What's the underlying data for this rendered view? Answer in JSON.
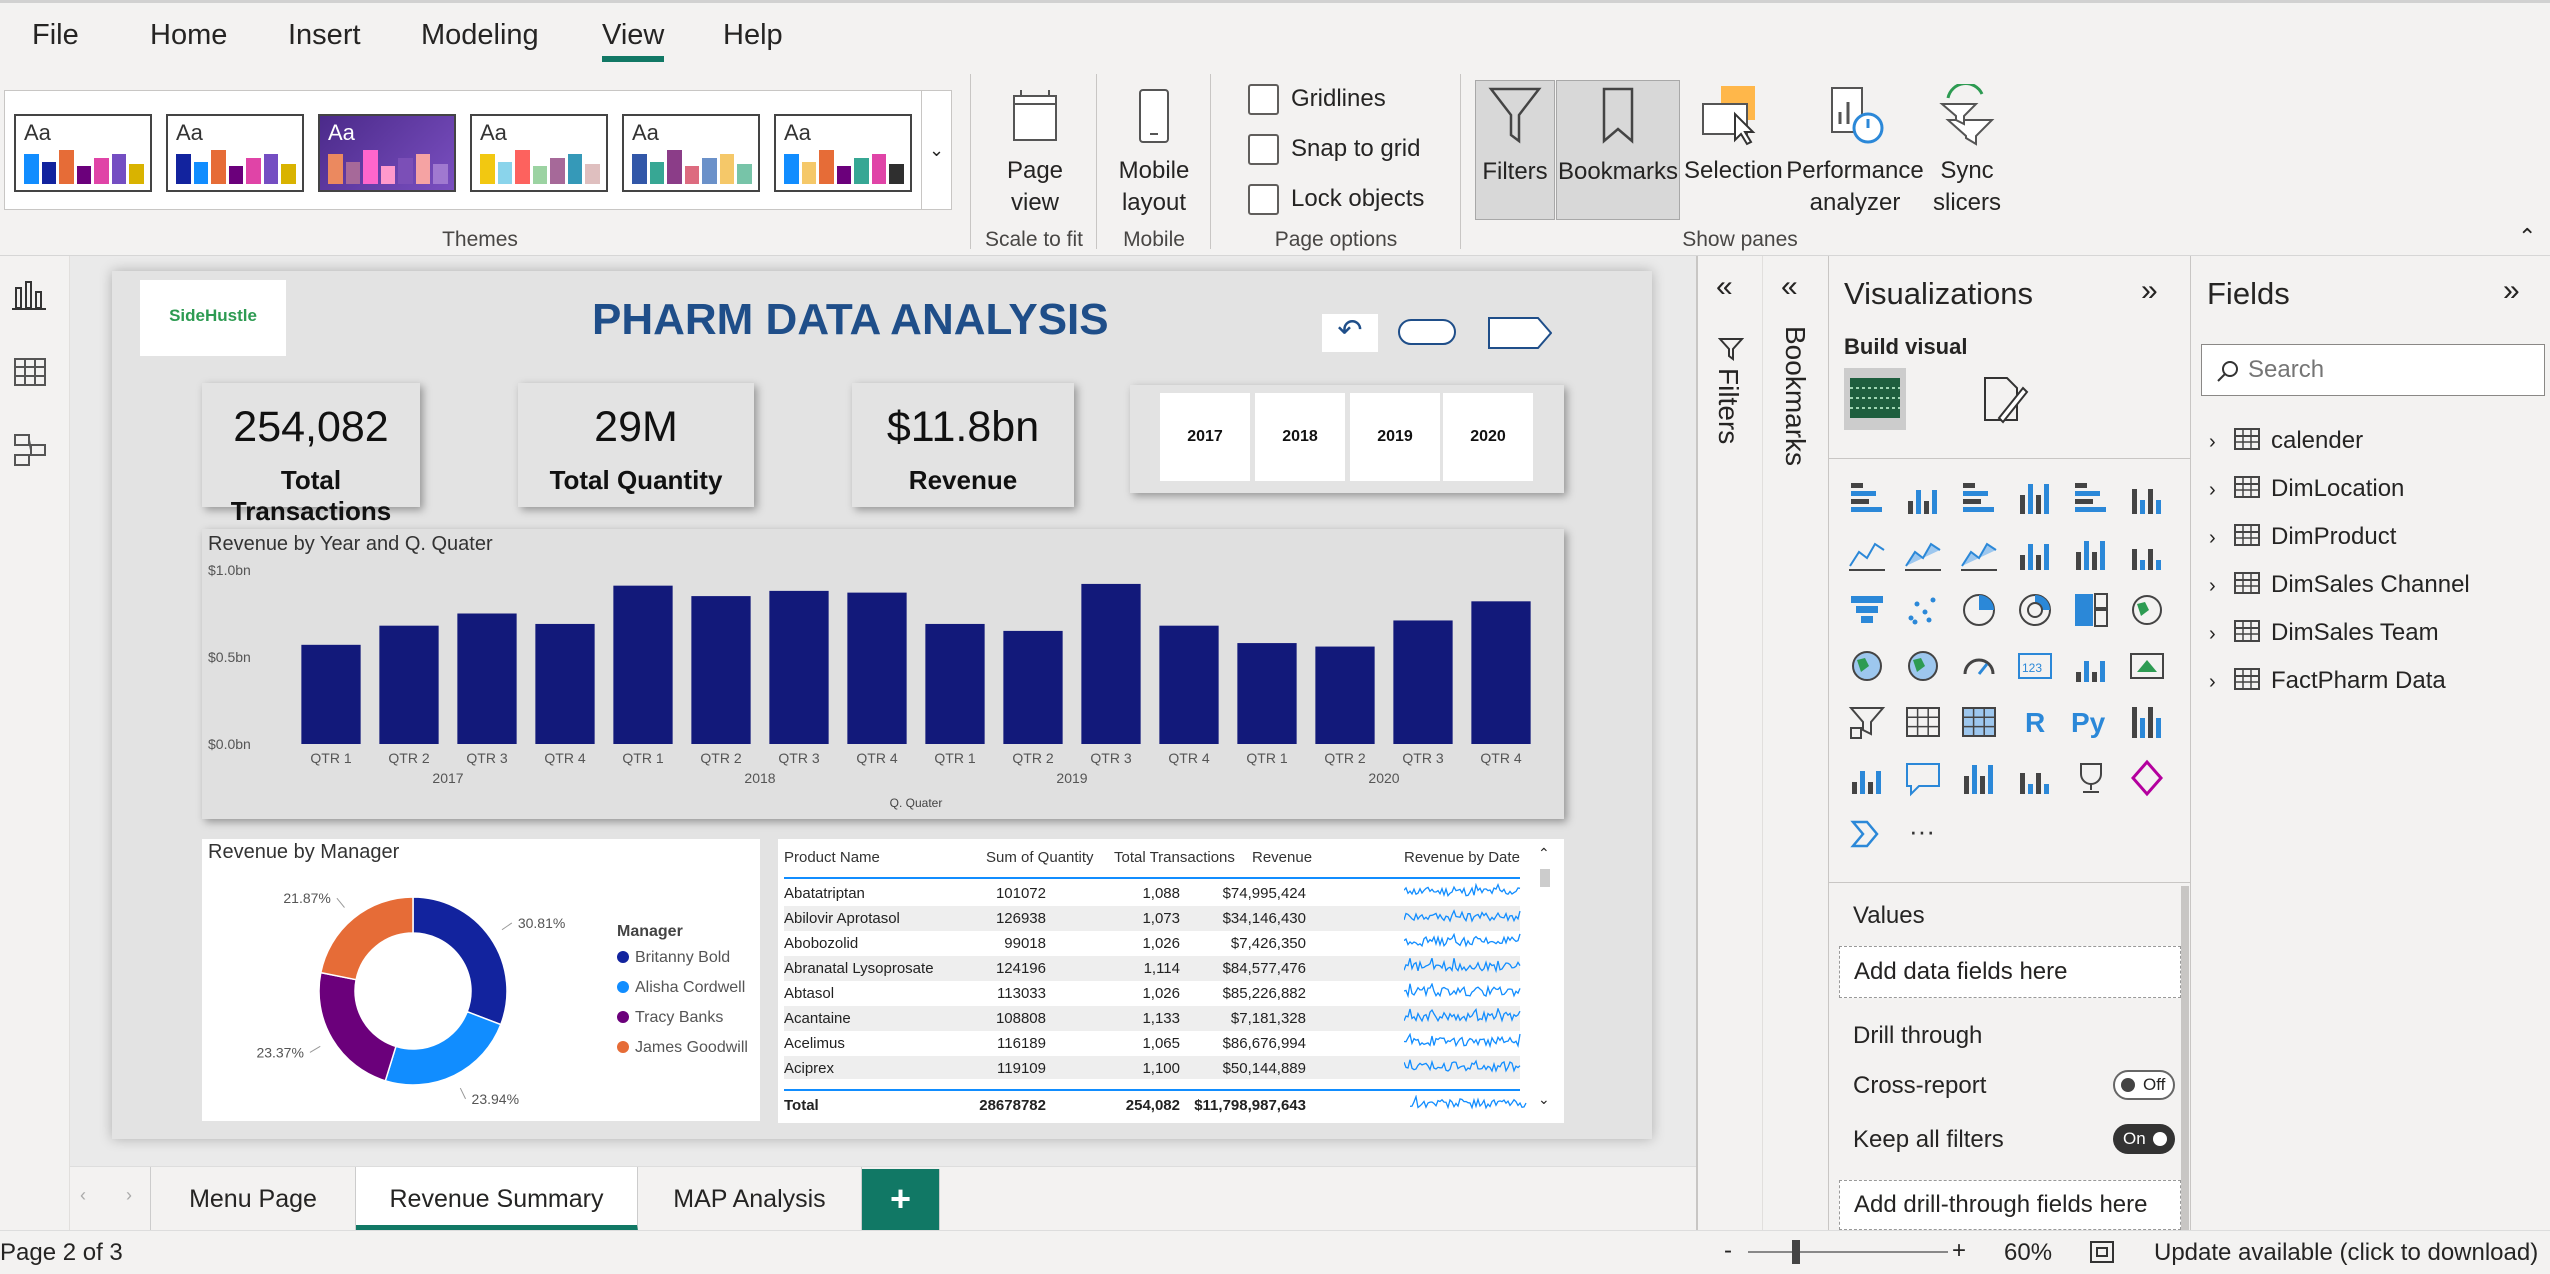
{
  "menu": [
    "File",
    "Home",
    "Insert",
    "Modeling",
    "View",
    "Help"
  ],
  "menu_active": "View",
  "ribbon": {
    "themes_label": "Themes",
    "page_view_label": "Page\nview",
    "scale_label": "Scale to fit",
    "mobile_label": "Mobile\nlayout",
    "mobile_group": "Mobile",
    "gridlines": "Gridlines",
    "snap": "Snap to grid",
    "lock": "Lock objects",
    "page_options_group": "Page options",
    "filters": "Filters",
    "bookmarks": "Bookmarks",
    "selection": "Selection",
    "perf": "Performance\nanalyzer",
    "sync": "Sync\nslicers",
    "show_panes_group": "Show panes",
    "theme_aa": "Aa"
  },
  "report": {
    "logo": "SideHustle",
    "title": "PHARM DATA ANALYSIS",
    "kpis": [
      {
        "value": "254,082",
        "label": "Total Transactions"
      },
      {
        "value": "29M",
        "label": "Total Quantity"
      },
      {
        "value": "$11.8bn",
        "label": "Revenue"
      }
    ],
    "years": [
      "2017",
      "2018",
      "2019",
      "2020"
    ],
    "bar_title": "Revenue by Year and Q. Quater",
    "bar_xlabel": "Q. Quater",
    "donut_title": "Revenue by Manager",
    "legend_title": "Manager"
  },
  "chart_data": [
    {
      "type": "bar",
      "title": "Revenue by Year and Q. Quater",
      "xlabel": "Q. Quater",
      "ylabel": "",
      "ylim": [
        0,
        1.0
      ],
      "y_ticks": [
        "$0.0bn",
        "$0.5bn",
        "$1.0bn"
      ],
      "categories": [
        "QTR 1",
        "QTR 2",
        "QTR 3",
        "QTR 4",
        "QTR 1",
        "QTR 2",
        "QTR 3",
        "QTR 4",
        "QTR 1",
        "QTR 2",
        "QTR 3",
        "QTR 4",
        "QTR 1",
        "QTR 2",
        "QTR 3",
        "QTR 4"
      ],
      "groups": [
        "2017",
        "2018",
        "2019",
        "2020"
      ],
      "values": [
        0.57,
        0.68,
        0.75,
        0.69,
        0.91,
        0.85,
        0.88,
        0.87,
        0.69,
        0.65,
        0.92,
        0.68,
        0.58,
        0.56,
        0.71,
        0.82
      ],
      "color": "#12197a"
    },
    {
      "type": "pie",
      "title": "Revenue by Manager",
      "labels": [
        "Britanny Bold",
        "Alisha Cordwell",
        "Tracy Banks",
        "James Goodwill"
      ],
      "values": [
        30.81,
        23.94,
        23.37,
        21.87
      ],
      "value_labels": [
        "30.81%",
        "23.94%",
        "23.37%",
        "21.87%"
      ],
      "colors": [
        "#12239e",
        "#118dff",
        "#6b007b",
        "#e66c37"
      ]
    }
  ],
  "table": {
    "headers": [
      "Product Name",
      "Sum of Quantity",
      "Total Transactions",
      "Revenue",
      "Revenue by Date"
    ],
    "rows": [
      [
        "Abatatriptan",
        "101072",
        "1,088",
        "$74,995,424"
      ],
      [
        "Abilovir Aprotasol",
        "126938",
        "1,073",
        "$34,146,430"
      ],
      [
        "Abobozolid",
        "99018",
        "1,026",
        "$7,426,350"
      ],
      [
        "Abranatal Lysoprosate",
        "124196",
        "1,114",
        "$84,577,476"
      ],
      [
        "Abtasol",
        "113033",
        "1,026",
        "$85,226,882"
      ],
      [
        "Acantaine",
        "108808",
        "1,133",
        "$7,181,328"
      ],
      [
        "Acelimus",
        "116189",
        "1,065",
        "$86,676,994"
      ],
      [
        "Aciprex",
        "119109",
        "1,100",
        "$50,144,889"
      ]
    ],
    "total": [
      "Total",
      "28678782",
      "254,082",
      "$11,798,987,643"
    ]
  },
  "tabs": [
    "Menu Page",
    "Revenue Summary",
    "MAP Analysis"
  ],
  "active_tab": "Revenue Summary",
  "add_tab": "+",
  "status": {
    "page": "Page 2 of 3",
    "zoom": "60%",
    "update": "Update available (click to download)",
    "minus": "-",
    "plus": "+"
  },
  "panes": {
    "filters": "Filters",
    "bookmarks": "Bookmarks",
    "viz_title": "Visualizations",
    "build_visual": "Build visual",
    "values": "Values",
    "add_data": "Add data fields here",
    "drill": "Drill through",
    "cross_report": "Cross-report",
    "cross_state": "Off",
    "keep_filters": "Keep all filters",
    "keep_state": "On",
    "add_drill": "Add drill-through fields here",
    "fields_title": "Fields",
    "search_placeholder": "Search",
    "tables": [
      "calender",
      "DimLocation",
      "DimProduct",
      "DimSales Channel",
      "DimSales Team",
      "FactPharm Data"
    ]
  }
}
